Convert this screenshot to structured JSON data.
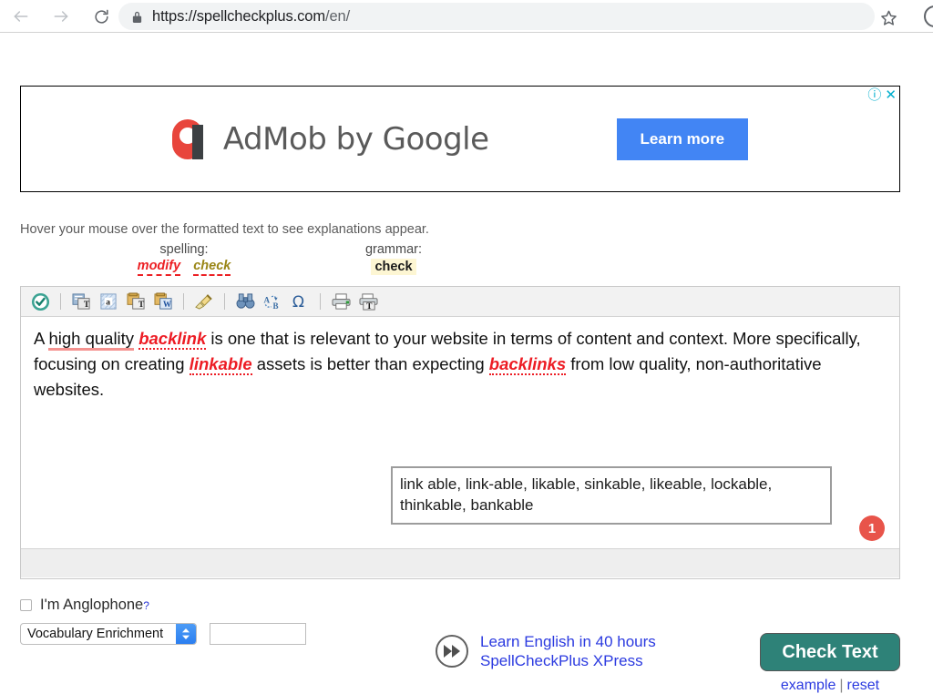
{
  "browser": {
    "back_icon": "back-arrow-icon",
    "forward_icon": "forward-arrow-icon",
    "reload_icon": "reload-icon",
    "lock_icon": "lock-icon",
    "url_prefix": "https://spellcheckplus.com",
    "url_suffix": "/en/",
    "star_icon": "star-icon",
    "profile_icon": "profile-avatar-icon"
  },
  "ad": {
    "info_glyph": "ⓘ",
    "close_glyph": "✕",
    "brand_text": "AdMob by Google",
    "cta_label": "Learn more",
    "accent_blue": "#4285f4",
    "logo_red": "#e8453c"
  },
  "hint": {
    "text": "Hover your mouse over the formatted text to see explanations appear."
  },
  "legend": {
    "spelling": {
      "heading": "spelling:",
      "modify_label": "modify",
      "check_label": "check"
    },
    "grammar": {
      "heading": "grammar:",
      "check_label": "check"
    },
    "colors": {
      "modify": "#ec2024",
      "spelling_check": "#9a8617",
      "grammar_highlight": "#fdf6d3"
    }
  },
  "editor": {
    "toolbar": [
      {
        "name": "spellcheck-icon",
        "glyph": "✔"
      },
      {
        "name": "separator",
        "glyph": ""
      },
      {
        "name": "paste-text-icon",
        "glyph": "T"
      },
      {
        "name": "paste-plain-a-icon",
        "glyph": "a"
      },
      {
        "name": "paste-from-clipboard-text-icon",
        "glyph": "T"
      },
      {
        "name": "paste-from-word-icon",
        "glyph": "W"
      },
      {
        "name": "separator",
        "glyph": ""
      },
      {
        "name": "clear-formatting-brush-icon",
        "glyph": ""
      },
      {
        "name": "separator",
        "glyph": ""
      },
      {
        "name": "find-binoculars-icon",
        "glyph": ""
      },
      {
        "name": "replace-icon",
        "glyph": "B"
      },
      {
        "name": "special-character-omega-icon",
        "glyph": "Ω"
      },
      {
        "name": "separator",
        "glyph": ""
      },
      {
        "name": "print-icon",
        "glyph": ""
      },
      {
        "name": "print-preview-text-icon",
        "glyph": "T"
      }
    ],
    "document": {
      "segments": [
        {
          "type": "plain",
          "text": "A "
        },
        {
          "type": "grammar",
          "text": "high quality"
        },
        {
          "type": "plain",
          "text": " "
        },
        {
          "type": "spell",
          "text": "backlink"
        },
        {
          "type": "plain",
          "text": " is one that is relevant to your website in terms of content and context. More specifically, focusing on creating "
        },
        {
          "type": "spell",
          "text": "linkable"
        },
        {
          "type": "plain",
          "text": " assets is better than expecting "
        },
        {
          "type": "spell",
          "text": "backlinks"
        },
        {
          "type": "plain",
          "text": " from low quality, non-authoritative websites."
        }
      ]
    },
    "tooltip": {
      "text": "link able, link-able, likable, sinkable, likeable, lockable, thinkable, bankable"
    },
    "error_badge": {
      "count": "1",
      "color": "#e8544a"
    }
  },
  "controls": {
    "anglophone_label": "I'm Anglophone",
    "anglophone_help": "?",
    "enrichment_selected": "Vocabulary Enrichment",
    "enrichment_input_value": "",
    "enrichment_input_placeholder": "",
    "promo_icon": "fast-forward-play-icon",
    "promo_line1": "Learn English in 40 hours",
    "promo_line2": "SpellCheckPlus XPress",
    "check_button_label": "Check Text",
    "example_link": "example",
    "links_separator": "|",
    "reset_link": "reset",
    "button_color": "#2e8278",
    "link_color": "#2b3ae0"
  }
}
